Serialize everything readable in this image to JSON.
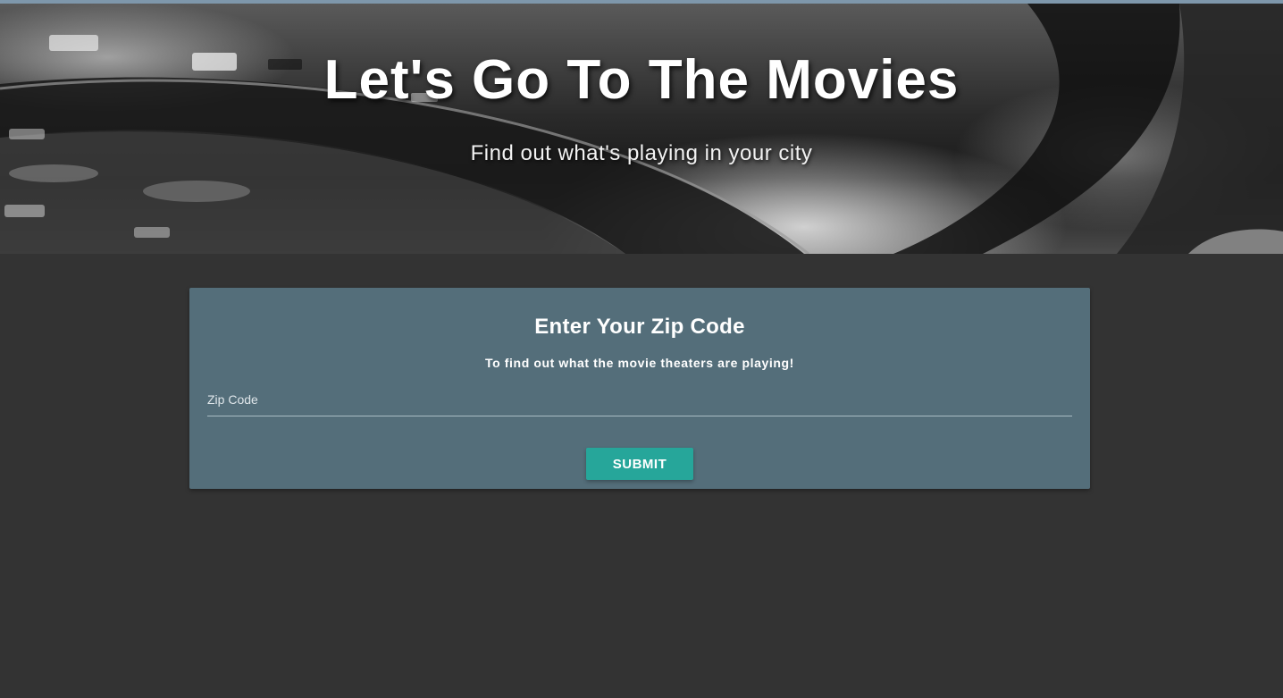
{
  "hero": {
    "title": "Let's Go To The Movies",
    "subtitle": "Find out what's playing in your city",
    "background_image": "theater-balcony-photo"
  },
  "zip_card": {
    "title": "Enter Your Zip Code",
    "subtitle": "To find out what the movie theaters are playing!",
    "zip_input": {
      "placeholder": "Zip Code",
      "value": ""
    },
    "submit_label": "SUBMIT"
  },
  "colors": {
    "page_background": "#333333",
    "card_background": "#546e7a",
    "button_accent": "#26a69a"
  }
}
